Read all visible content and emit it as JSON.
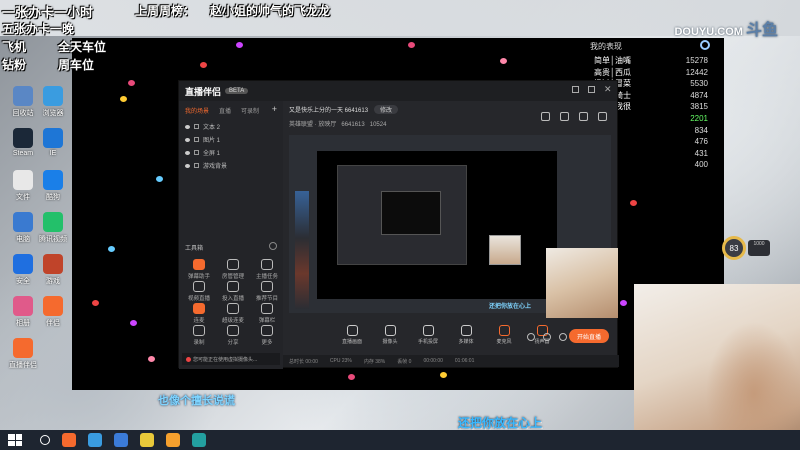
{
  "overlay": {
    "line1": "一张办卡一小时",
    "line2": "上周周榜：",
    "line3": "赵小姐的帅气的飞龙龙",
    "line4": "五张办卡一晚",
    "line5": "飞机",
    "line6": "全天车位",
    "line7": "钻粉",
    "line8": "周车位"
  },
  "brand": {
    "site": "DOUYU.COM",
    "name": "斗鱼"
  },
  "desktop_icons": [
    {
      "label": "回收站",
      "color": "#5a87c5"
    },
    {
      "label": "浏览器",
      "color": "#3a9ce0"
    },
    {
      "label": "Steam",
      "color": "#1b2838"
    },
    {
      "label": "IE",
      "color": "#1e76d6"
    },
    {
      "label": "文件",
      "color": "#e8e8e8"
    },
    {
      "label": "酷狗",
      "color": "#1a7fe8"
    },
    {
      "label": "电脑",
      "color": "#3a7ad0"
    },
    {
      "label": "腾讯视频",
      "color": "#23c06a"
    },
    {
      "label": "安全",
      "color": "#1f6fe0"
    },
    {
      "label": "游戏",
      "color": "#c0442a"
    },
    {
      "label": "相册",
      "color": "#e05a8a"
    },
    {
      "label": "伴侣",
      "color": "#f56a2e"
    },
    {
      "label": "直播伴侣",
      "color": "#f56a2e"
    }
  ],
  "leaderboard": {
    "title": "我的表现",
    "rows": [
      {
        "name": "简单│油嘴",
        "value": "15278"
      },
      {
        "name": "高贵│西瓜",
        "value": "12442"
      },
      {
        "name": "杨过│冒菜",
        "value": "5530"
      },
      {
        "name": "宠宝│骑士",
        "value": "4874"
      },
      {
        "name": "亚飞│我很",
        "value": "3815"
      },
      {
        "name": "",
        "value": "2201",
        "highlight": true
      },
      {
        "name": "",
        "value": "834"
      },
      {
        "name": "",
        "value": "476"
      },
      {
        "name": "",
        "value": "431"
      },
      {
        "name": "",
        "value": "400"
      }
    ]
  },
  "app": {
    "logo": "直播伴侣",
    "badge": "BETA",
    "tabs": [
      "我的场景",
      "直播",
      "可录制"
    ],
    "layers": [
      "文本 2",
      "图片 1",
      "全屏 1",
      "游戏背景"
    ],
    "toolbox_title": "工具箱",
    "tools": [
      "弹幕助手",
      "房管管理",
      "主播任务",
      "视频直播",
      "投入直播",
      "推荐节目",
      "连麦",
      "超级连麦",
      "弹幕栏",
      "录制",
      "分享",
      "更多"
    ],
    "notice": "您可能正在使用虚拟摄像头...",
    "room_title": "又是快乐上分的一天 6641613",
    "edit_label": "修改",
    "category_label": "英雄联盟 · 放映厅",
    "room_id": "6641613",
    "fans": "10524",
    "preview_caption": "还把你放在心上",
    "bottom_tools": [
      "直播画面",
      "摄像头",
      "手机投屏",
      "多媒体",
      "麦克风",
      "扬声器"
    ],
    "live_button": "开始直播",
    "status": [
      "总时长 00:00",
      "CPU 23%",
      "内存 38%",
      "丢帧 0",
      "00:00:00",
      "01:06:01"
    ]
  },
  "rank": {
    "value": "83",
    "side": "1000"
  },
  "lyrics": {
    "line1": "也像个擅长说谎",
    "line2": "还把你放在心上"
  },
  "taskbar": [
    "伴侣",
    "浏览器",
    "Chrome",
    "文件",
    "录屏",
    "游戏"
  ]
}
